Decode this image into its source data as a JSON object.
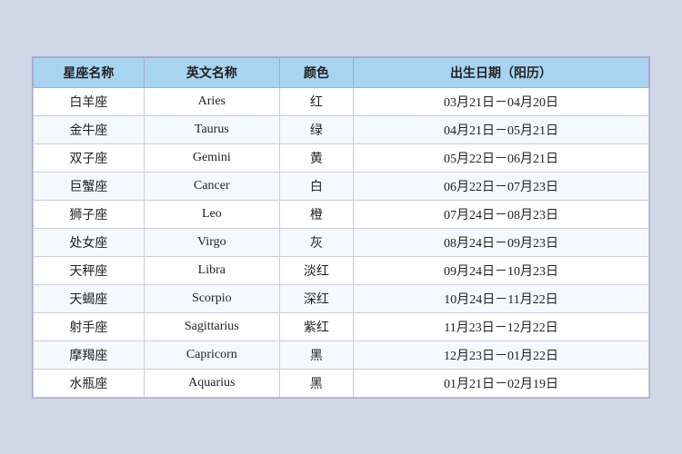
{
  "table": {
    "headers": [
      "星座名称",
      "英文名称",
      "颜色",
      "出生日期（阳历）"
    ],
    "rows": [
      {
        "chinese": "白羊座",
        "english": "Aries",
        "color": "红",
        "date": "03月21日－04月20日"
      },
      {
        "chinese": "金牛座",
        "english": "Taurus",
        "color": "绿",
        "date": "04月21日－05月21日"
      },
      {
        "chinese": "双子座",
        "english": "Gemini",
        "color": "黄",
        "date": "05月22日－06月21日"
      },
      {
        "chinese": "巨蟹座",
        "english": "Cancer",
        "color": "白",
        "date": "06月22日－07月23日"
      },
      {
        "chinese": "狮子座",
        "english": "Leo",
        "color": "橙",
        "date": "07月24日－08月23日"
      },
      {
        "chinese": "处女座",
        "english": "Virgo",
        "color": "灰",
        "date": "08月24日－09月23日"
      },
      {
        "chinese": "天秤座",
        "english": "Libra",
        "color": "淡红",
        "date": "09月24日－10月23日"
      },
      {
        "chinese": "天蝎座",
        "english": "Scorpio",
        "color": "深红",
        "date": "10月24日－11月22日"
      },
      {
        "chinese": "射手座",
        "english": "Sagittarius",
        "color": "紫红",
        "date": "11月23日－12月22日"
      },
      {
        "chinese": "摩羯座",
        "english": "Capricorn",
        "color": "黑",
        "date": "12月23日－01月22日"
      },
      {
        "chinese": "水瓶座",
        "english": "Aquarius",
        "color": "黑",
        "date": "01月21日－02月19日"
      }
    ]
  }
}
